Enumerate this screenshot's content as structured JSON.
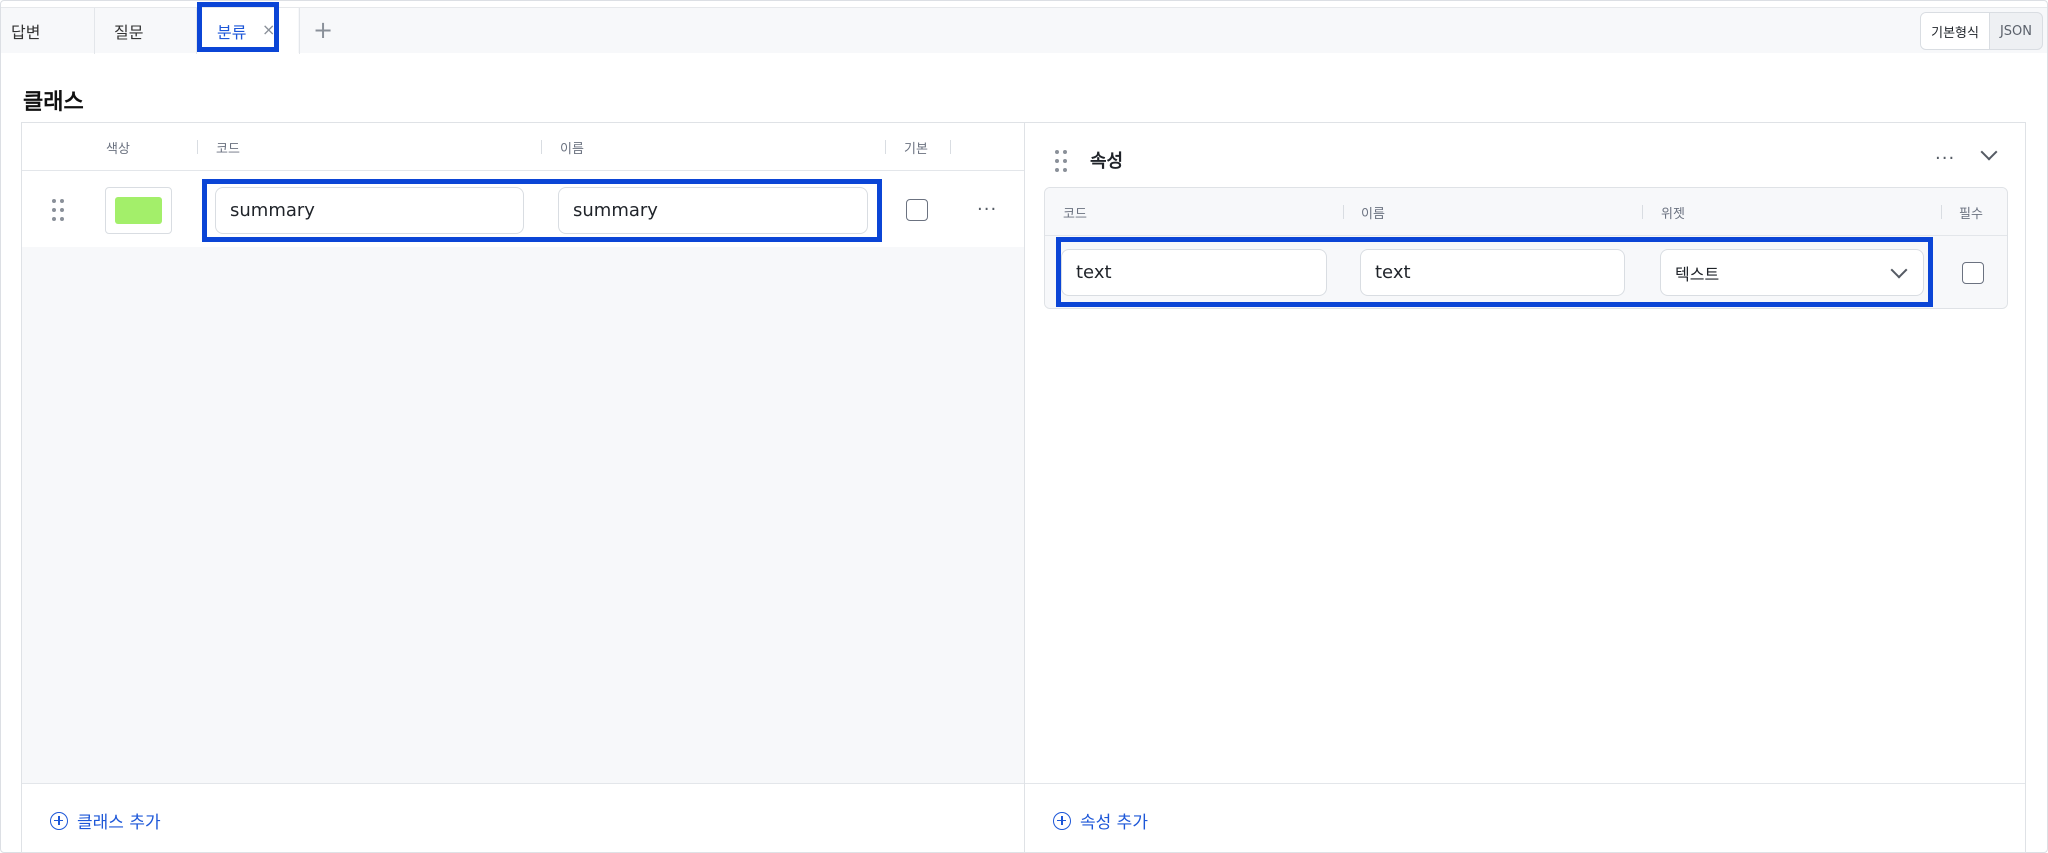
{
  "tabs": [
    {
      "label": "답변"
    },
    {
      "label": "질문"
    },
    {
      "label": "분류",
      "active": true,
      "close": "×"
    }
  ],
  "tab_add": "+",
  "view_mode": {
    "basic": "기본형식",
    "json": "JSON",
    "selected": "기본형식"
  },
  "page_title": "클래스",
  "class_table": {
    "headers": {
      "color": "색상",
      "code": "코드",
      "name": "이름",
      "default": "기본"
    },
    "rows": [
      {
        "color": "#a3ef6a",
        "code": "summary",
        "name": "summary",
        "default": false
      }
    ],
    "add_label": "클래스 추가"
  },
  "attributes": {
    "title": "속성",
    "headers": {
      "code": "코드",
      "name": "이름",
      "widget": "위젯",
      "required": "필수"
    },
    "rows": [
      {
        "code": "text",
        "name": "text",
        "widget": "텍스트",
        "required": false
      }
    ],
    "add_label": "속성 추가"
  },
  "more_icon": "···",
  "icons": {
    "close": "close-icon",
    "add_tab": "plus-icon",
    "drag": "drag-handle-icon",
    "more": "more-horizontal-icon",
    "collapse": "chevron-down-icon",
    "add": "plus-circle-icon"
  },
  "colors": {
    "accent": "#1d57d8",
    "highlight": "#0b45d6",
    "swatch": "#a3ef6a"
  }
}
